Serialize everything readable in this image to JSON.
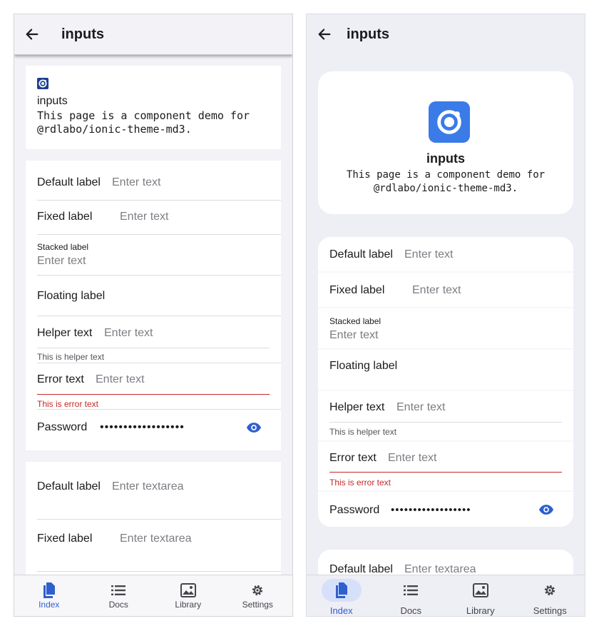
{
  "header": {
    "title": "inputs"
  },
  "hero": {
    "title": "inputs",
    "description_line1": "This page is a component demo for",
    "description_line2": "@rdlabo/ionic-theme-md3."
  },
  "inputs": {
    "default_label": "Default label",
    "fixed_label": "Fixed label",
    "stacked_label": "Stacked label",
    "floating_label": "Floating label",
    "helper_label": "Helper text",
    "error_label": "Error text",
    "password_label": "Password",
    "placeholder": "Enter text",
    "helper_text": "This is helper text",
    "error_text": "This is error text",
    "password_value": "••••••••••••••••••"
  },
  "textareas": {
    "default_label": "Default label",
    "fixed_label": "Fixed label",
    "placeholder": "Enter textarea"
  },
  "tabs": [
    {
      "label": "Index",
      "icon": "documents-icon"
    },
    {
      "label": "Docs",
      "icon": "list-icon"
    },
    {
      "label": "Library",
      "icon": "images-icon"
    },
    {
      "label": "Settings",
      "icon": "gear-icon"
    }
  ],
  "colors": {
    "primary": "#2f5fcf",
    "error": "#c62828",
    "active_pill": "#d6e0fb"
  }
}
